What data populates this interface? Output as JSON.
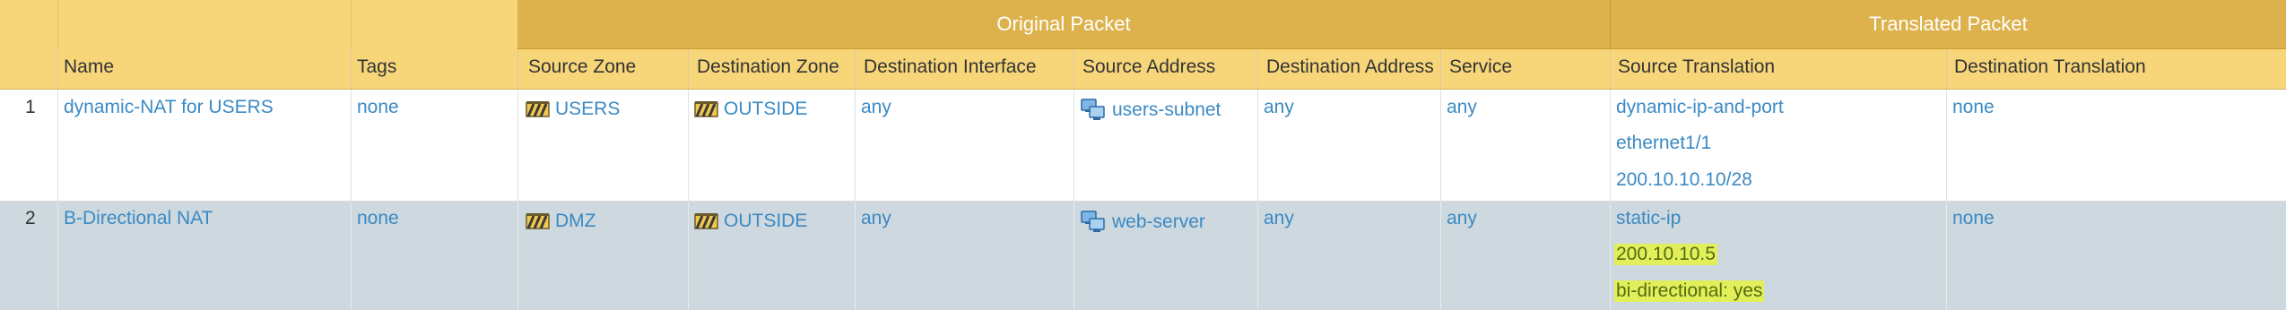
{
  "header": {
    "groups": {
      "original": "Original Packet",
      "translated": "Translated Packet"
    },
    "columns": {
      "name": "Name",
      "tags": "Tags",
      "source_zone": "Source Zone",
      "destination_zone": "Destination Zone",
      "destination_interface": "Destination Interface",
      "source_address": "Source Address",
      "destination_address": "Destination Address",
      "service": "Service",
      "source_translation": "Source Translation",
      "destination_translation": "Destination Translation"
    }
  },
  "rows": [
    {
      "num": "1",
      "name": "dynamic-NAT for USERS",
      "tags": "none",
      "source_zone": "USERS",
      "destination_zone": "OUTSIDE",
      "destination_interface": "any",
      "source_address": "users-subnet",
      "destination_address": "any",
      "service": "any",
      "source_translation": [
        "dynamic-ip-and-port",
        "ethernet1/1",
        "200.10.10.10/28"
      ],
      "destination_translation": "none"
    },
    {
      "num": "2",
      "name": "B-Directional NAT",
      "tags": "none",
      "source_zone": "DMZ",
      "destination_zone": "OUTSIDE",
      "destination_interface": "any",
      "source_address": "web-server",
      "destination_address": "any",
      "service": "any",
      "source_translation": [
        "static-ip",
        "200.10.10.5",
        "bi-directional: yes"
      ],
      "destination_translation": "none"
    }
  ],
  "icons": {
    "zone": "zone-icon",
    "address": "address-object-icon"
  },
  "colors": {
    "header": "#f7d67a",
    "header_group": "#ddb24c",
    "link": "#3b8ac4",
    "selected_row": "#cdd8df",
    "highlight": "#e1f05a"
  }
}
